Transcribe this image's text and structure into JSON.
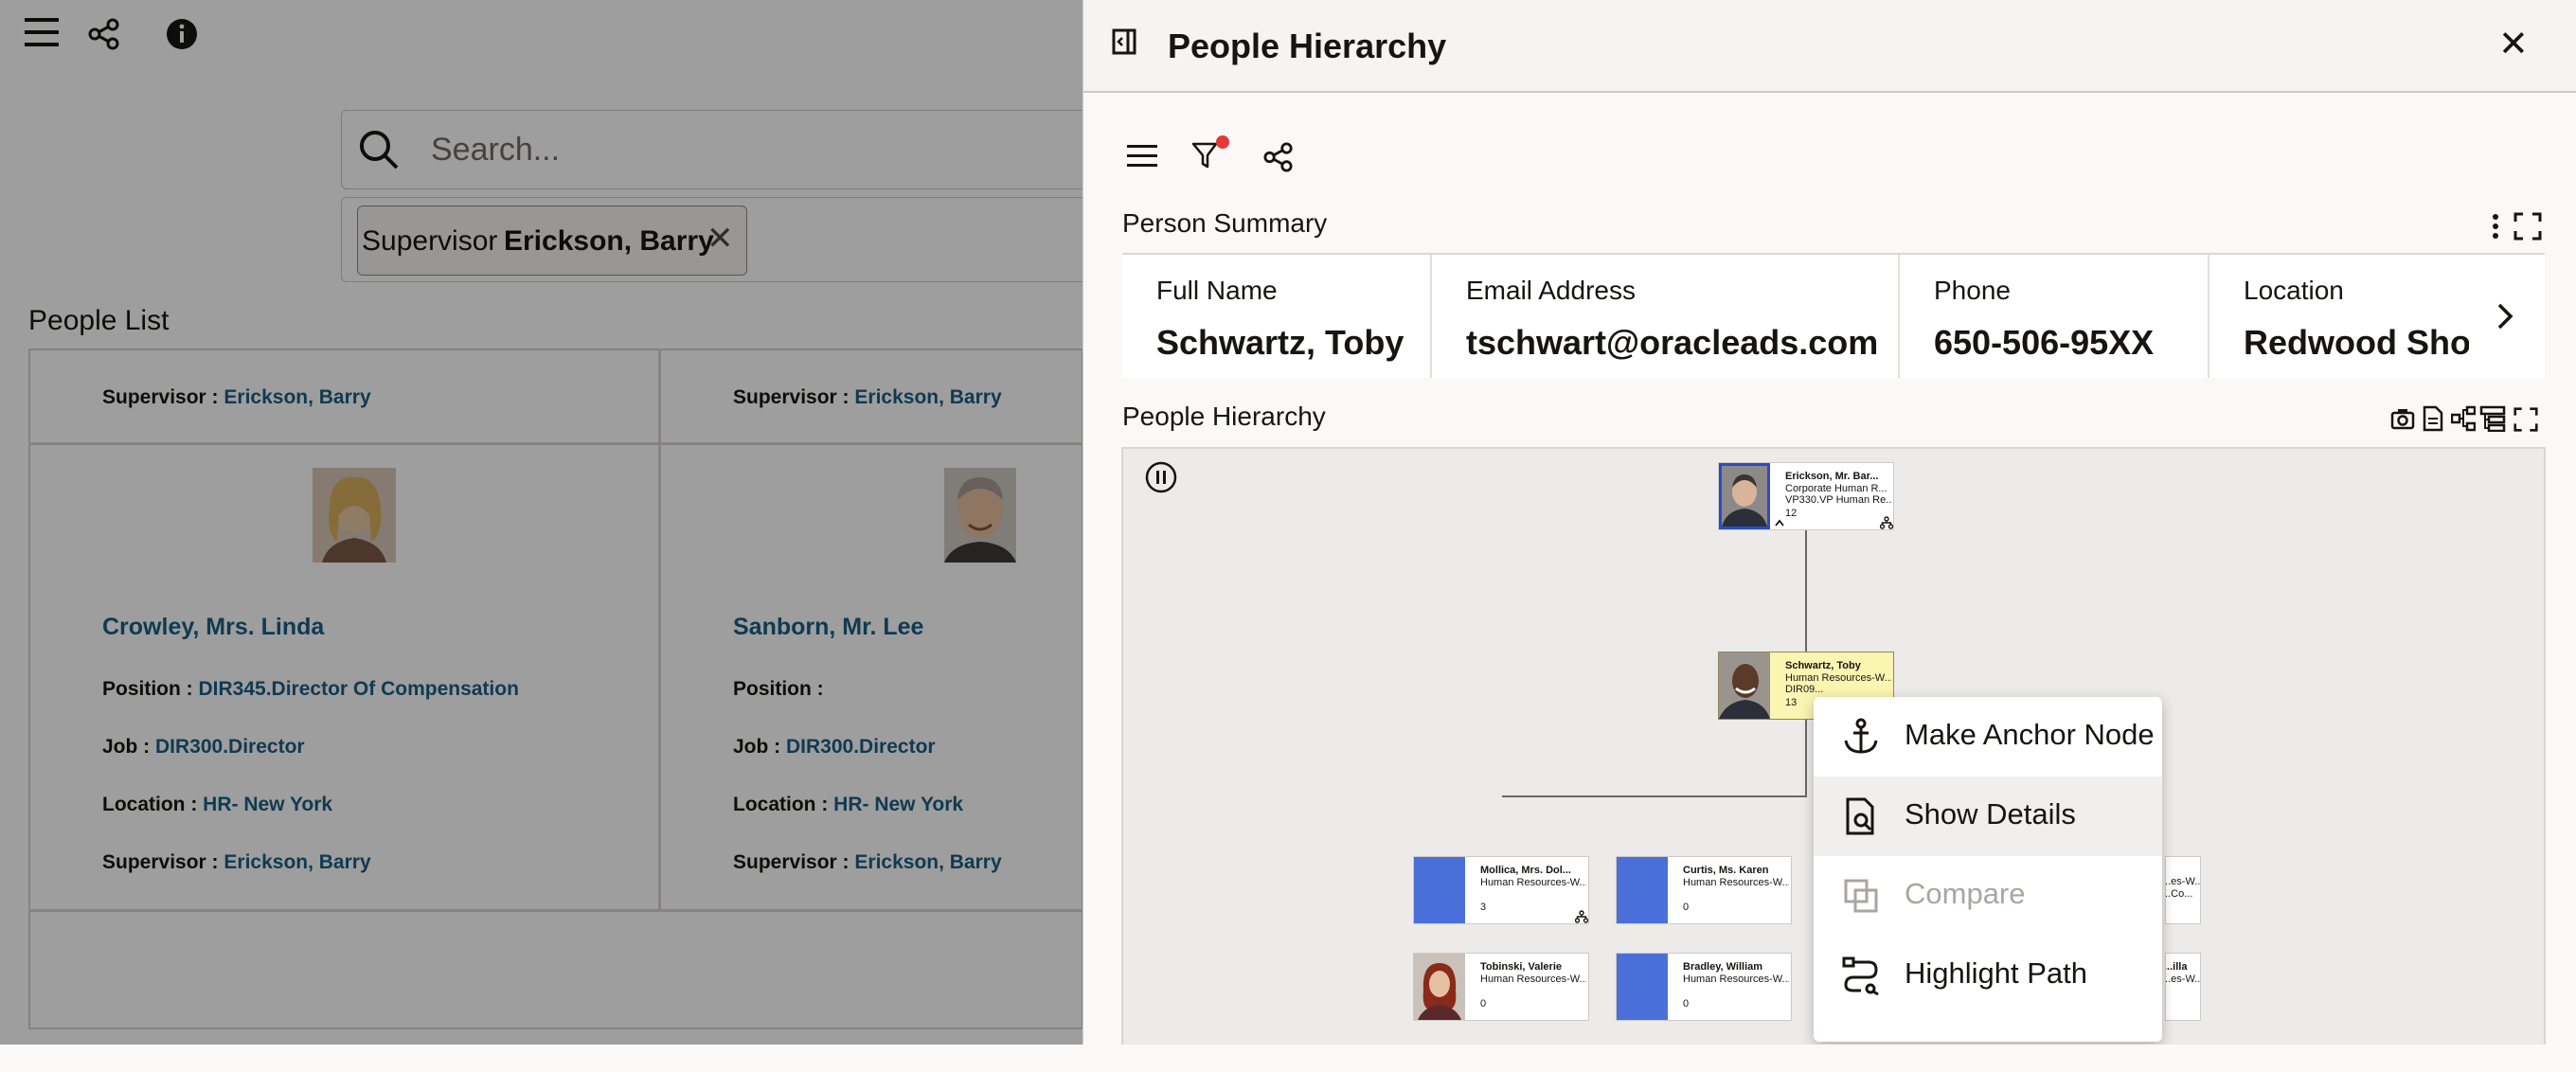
{
  "background": {
    "search": {
      "placeholder": "Search..."
    },
    "filter_chip": {
      "key": "Supervisor",
      "value": "Erickson, Barry",
      "remove": "✕"
    },
    "section_title": "People List",
    "rows": [
      {
        "supervisor_label": "Supervisor :",
        "supervisor_value": "Erickson, Barry"
      }
    ],
    "cards": [
      {
        "name": "Crowley, Mrs. Linda",
        "position_label": "Position :",
        "position_value": "DIR345.Director Of Compensation",
        "job_label": "Job :",
        "job_value": "DIR300.Director",
        "location_label": "Location :",
        "location_value": "HR- New York",
        "supervisor_label": "Supervisor :",
        "supervisor_value": "Erickson, Barry"
      },
      {
        "name": "Sanborn, Mr. Lee",
        "position_label": "Position :",
        "position_value": "",
        "job_label": "Job :",
        "job_value": "DIR300.Director",
        "location_label": "Location :",
        "location_value": "HR- New York",
        "supervisor_label": "Supervisor :",
        "supervisor_value": "Erickson, Barry"
      }
    ]
  },
  "drawer": {
    "title": "People Hierarchy",
    "close": "✕",
    "summary": {
      "title": "Person Summary",
      "fields": [
        {
          "label": "Full Name",
          "value": "Schwartz, Toby"
        },
        {
          "label": "Email Address",
          "value": "tschwart@oracleads.com"
        },
        {
          "label": "Phone",
          "value": "650-506-95XX"
        },
        {
          "label": "Location",
          "value": "Redwood Sho"
        }
      ]
    },
    "hierarchy": {
      "title": "People Hierarchy",
      "nodes": [
        {
          "name": "Erickson, Mr. Bar...",
          "line1": "Corporate Human R...",
          "line2": "VP330.VP Human Re...",
          "count": "12"
        },
        {
          "name": "Schwartz, Toby",
          "line1": "Human Resources-W...",
          "line2": "DIR09...",
          "count": "13"
        },
        {
          "name": "Mollica, Mrs. Dol...",
          "line1": "Human Resources-W...",
          "line2": "",
          "count": "3"
        },
        {
          "name": "Curtis, Ms. Karen",
          "line1": "Human Resources-W...",
          "line2": "",
          "count": "0"
        },
        {
          "name": "Tobinski, Valerie",
          "line1": "Human Resources-W...",
          "line2": "",
          "count": "0"
        },
        {
          "name": "Bradley, William",
          "line1": "Human Resources-W...",
          "line2": "",
          "count": "0"
        },
        {
          "name": "",
          "line1": "...es-W...",
          "line2": "...Co...",
          "count": ""
        },
        {
          "name": "...illa",
          "line1": "...es-W...",
          "line2": "",
          "count": ""
        }
      ]
    },
    "context_menu": {
      "items": [
        {
          "label": "Make Anchor Node",
          "icon": "anchor-icon",
          "enabled": true
        },
        {
          "label": "Show Details",
          "icon": "document-search-icon",
          "enabled": true
        },
        {
          "label": "Compare",
          "icon": "compare-icon",
          "enabled": false
        },
        {
          "label": "Highlight Path",
          "icon": "highlight-path-icon",
          "enabled": true
        }
      ]
    }
  },
  "colors": {
    "link": "#1b5e83",
    "node_placeholder": "#4a6fd8",
    "selected_node": "#fbf5b2",
    "filter_badge": "#e53935"
  }
}
